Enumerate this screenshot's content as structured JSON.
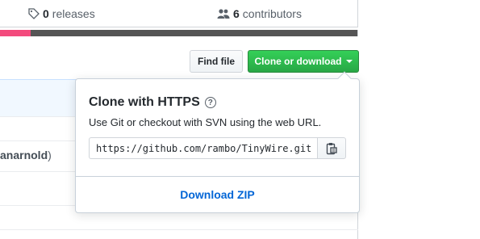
{
  "stats": {
    "releases": {
      "count": "0",
      "label": "releases",
      "icon": "tag-icon"
    },
    "contributors": {
      "count": "6",
      "label": "contributors",
      "icon": "people-icon"
    }
  },
  "language_bar": {
    "segments": [
      {
        "color": "#f34b7d",
        "percent": 8.5
      },
      {
        "color": "#555555",
        "percent": 91.5
      }
    ]
  },
  "toolbar": {
    "find_file": "Find file",
    "clone": "Clone or download"
  },
  "filelist": {
    "author_fragment": "anarnold",
    "author_suffix": ")"
  },
  "clone_panel": {
    "title": "Clone with HTTPS",
    "help_icon": "question-icon",
    "description": "Use Git or checkout with SVN using the web URL.",
    "url": "https://github.com/rambo/TinyWire.git",
    "copy_icon": "clipboard-icon",
    "download": "Download ZIP"
  }
}
